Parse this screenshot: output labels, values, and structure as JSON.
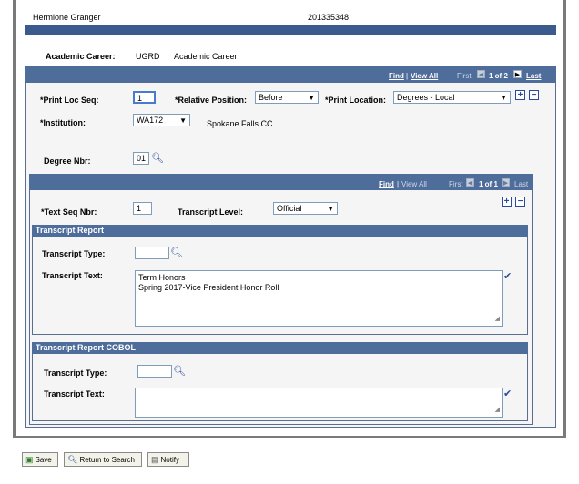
{
  "header": {
    "name": "Hermione Granger",
    "id": "201335348"
  },
  "career": {
    "label": "Academic Career:",
    "code": "UGRD",
    "description": "Academic Career"
  },
  "outer_nav": {
    "find": "Find",
    "view_all": "View All",
    "first": "First",
    "range": "1 of 2",
    "last": "Last"
  },
  "print": {
    "loc_seq_label": "*Print Loc Seq:",
    "loc_seq_value": "1",
    "rel_pos_label": "*Relative Position:",
    "rel_pos_value": "Before",
    "location_label": "*Print Location:",
    "location_value": "Degrees - Local"
  },
  "institution": {
    "label": "*Institution:",
    "value": "WA172",
    "description": "Spokane Falls CC"
  },
  "degree": {
    "label": "Degree Nbr:",
    "value": "01"
  },
  "inner_nav": {
    "find": "Find",
    "view_all": "View All",
    "first": "First",
    "range": "1 of 1",
    "last": "Last"
  },
  "text_seq": {
    "label": "*Text Seq Nbr:",
    "value": "1"
  },
  "transcript_level": {
    "label": "Transcript Level:",
    "value": "Official"
  },
  "report": {
    "title": "Transcript Report",
    "type_label": "Transcript Type:",
    "type_value": "",
    "text_label": "Transcript Text:",
    "text_line1": "Term Honors",
    "text_line2": "Spring 2017-Vice President Honor Roll"
  },
  "cobol": {
    "title": "Transcript Report COBOL",
    "type_label": "Transcript Type:",
    "type_value": "",
    "text_label": "Transcript Text:",
    "text_value": ""
  },
  "buttons": {
    "save": "Save",
    "return": "Return to Search",
    "notify": "Notify"
  },
  "colors": {
    "header_bar": "#3b5b8f",
    "section_bar": "#4f6d9b",
    "link": "#2b4a9a"
  }
}
